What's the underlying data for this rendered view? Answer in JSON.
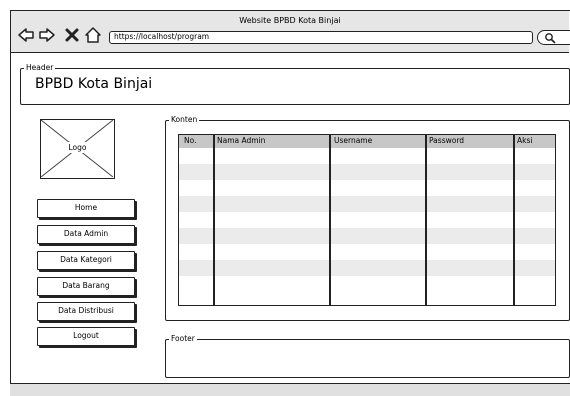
{
  "window": {
    "title": "Website BPBD Kota Binjai"
  },
  "address_bar": {
    "url": "https://localhost/program"
  },
  "header": {
    "legend": "Header",
    "title": "BPBD Kota Binjai"
  },
  "logo": {
    "label": "Logo"
  },
  "menu": {
    "items": [
      "Home",
      "Data Admin",
      "Data Kategori",
      "Data Barang",
      "Data Distribusi",
      "Logout"
    ]
  },
  "content": {
    "legend": "Konten",
    "table": {
      "columns": [
        "No.",
        "Nama Admin",
        "Username",
        "Password",
        "Aksi"
      ],
      "rows": [
        [
          "",
          "",
          "",
          "",
          ""
        ],
        [
          "",
          "",
          "",
          "",
          ""
        ],
        [
          "",
          "",
          "",
          "",
          ""
        ],
        [
          "",
          "",
          "",
          "",
          ""
        ],
        [
          "",
          "",
          "",
          "",
          ""
        ],
        [
          "",
          "",
          "",
          "",
          ""
        ],
        [
          "",
          "",
          "",
          "",
          ""
        ],
        [
          "",
          "",
          "",
          "",
          ""
        ],
        [
          "",
          "",
          "",
          "",
          ""
        ]
      ]
    }
  },
  "footer": {
    "legend": "Footer"
  },
  "icons": [
    "back-arrow-icon",
    "forward-arrow-icon",
    "close-icon",
    "home-icon",
    "search-icon"
  ]
}
